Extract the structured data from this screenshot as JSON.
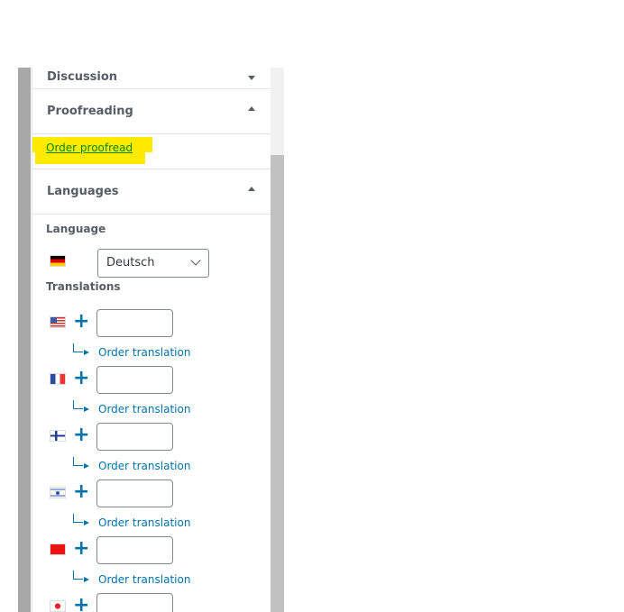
{
  "sections": {
    "discussion": "Discussion",
    "proofreading": "Proofreading",
    "languages": "Languages"
  },
  "proofreading": {
    "order_link": "Order proofread",
    "highlight_color": "#ffea00"
  },
  "languages": {
    "language_label": "Language",
    "current_flag": "de",
    "selected": "Deutsch",
    "translations_label": "Translations",
    "translations": [
      {
        "flag": "us",
        "value": "",
        "link": "Order translation"
      },
      {
        "flag": "fr",
        "value": "",
        "link": "Order translation"
      },
      {
        "flag": "fi",
        "value": "",
        "link": "Order translation"
      },
      {
        "flag": "il",
        "value": "",
        "link": "Order translation"
      },
      {
        "flag": "ma",
        "value": "",
        "link": "Order translation"
      },
      {
        "flag": "jp",
        "value": "",
        "link": ""
      }
    ]
  },
  "colors": {
    "accent": "#0073aa",
    "link_green": "#008a00"
  }
}
